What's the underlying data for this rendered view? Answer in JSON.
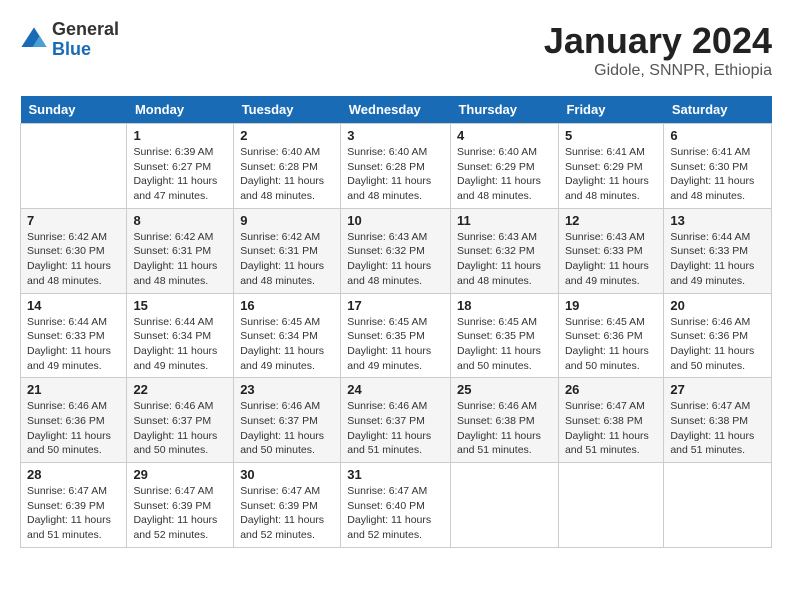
{
  "header": {
    "logo_general": "General",
    "logo_blue": "Blue",
    "month_title": "January 2024",
    "location": "Gidole, SNNPR, Ethiopia"
  },
  "weekdays": [
    "Sunday",
    "Monday",
    "Tuesday",
    "Wednesday",
    "Thursday",
    "Friday",
    "Saturday"
  ],
  "weeks": [
    [
      null,
      {
        "day": 1,
        "sunrise": "6:39 AM",
        "sunset": "6:27 PM",
        "daylight": "11 hours and 47 minutes."
      },
      {
        "day": 2,
        "sunrise": "6:40 AM",
        "sunset": "6:28 PM",
        "daylight": "11 hours and 48 minutes."
      },
      {
        "day": 3,
        "sunrise": "6:40 AM",
        "sunset": "6:28 PM",
        "daylight": "11 hours and 48 minutes."
      },
      {
        "day": 4,
        "sunrise": "6:40 AM",
        "sunset": "6:29 PM",
        "daylight": "11 hours and 48 minutes."
      },
      {
        "day": 5,
        "sunrise": "6:41 AM",
        "sunset": "6:29 PM",
        "daylight": "11 hours and 48 minutes."
      },
      {
        "day": 6,
        "sunrise": "6:41 AM",
        "sunset": "6:30 PM",
        "daylight": "11 hours and 48 minutes."
      }
    ],
    [
      {
        "day": 7,
        "sunrise": "6:42 AM",
        "sunset": "6:30 PM",
        "daylight": "11 hours and 48 minutes."
      },
      {
        "day": 8,
        "sunrise": "6:42 AM",
        "sunset": "6:31 PM",
        "daylight": "11 hours and 48 minutes."
      },
      {
        "day": 9,
        "sunrise": "6:42 AM",
        "sunset": "6:31 PM",
        "daylight": "11 hours and 48 minutes."
      },
      {
        "day": 10,
        "sunrise": "6:43 AM",
        "sunset": "6:32 PM",
        "daylight": "11 hours and 48 minutes."
      },
      {
        "day": 11,
        "sunrise": "6:43 AM",
        "sunset": "6:32 PM",
        "daylight": "11 hours and 48 minutes."
      },
      {
        "day": 12,
        "sunrise": "6:43 AM",
        "sunset": "6:33 PM",
        "daylight": "11 hours and 49 minutes."
      },
      {
        "day": 13,
        "sunrise": "6:44 AM",
        "sunset": "6:33 PM",
        "daylight": "11 hours and 49 minutes."
      }
    ],
    [
      {
        "day": 14,
        "sunrise": "6:44 AM",
        "sunset": "6:33 PM",
        "daylight": "11 hours and 49 minutes."
      },
      {
        "day": 15,
        "sunrise": "6:44 AM",
        "sunset": "6:34 PM",
        "daylight": "11 hours and 49 minutes."
      },
      {
        "day": 16,
        "sunrise": "6:45 AM",
        "sunset": "6:34 PM",
        "daylight": "11 hours and 49 minutes."
      },
      {
        "day": 17,
        "sunrise": "6:45 AM",
        "sunset": "6:35 PM",
        "daylight": "11 hours and 49 minutes."
      },
      {
        "day": 18,
        "sunrise": "6:45 AM",
        "sunset": "6:35 PM",
        "daylight": "11 hours and 50 minutes."
      },
      {
        "day": 19,
        "sunrise": "6:45 AM",
        "sunset": "6:36 PM",
        "daylight": "11 hours and 50 minutes."
      },
      {
        "day": 20,
        "sunrise": "6:46 AM",
        "sunset": "6:36 PM",
        "daylight": "11 hours and 50 minutes."
      }
    ],
    [
      {
        "day": 21,
        "sunrise": "6:46 AM",
        "sunset": "6:36 PM",
        "daylight": "11 hours and 50 minutes."
      },
      {
        "day": 22,
        "sunrise": "6:46 AM",
        "sunset": "6:37 PM",
        "daylight": "11 hours and 50 minutes."
      },
      {
        "day": 23,
        "sunrise": "6:46 AM",
        "sunset": "6:37 PM",
        "daylight": "11 hours and 50 minutes."
      },
      {
        "day": 24,
        "sunrise": "6:46 AM",
        "sunset": "6:37 PM",
        "daylight": "11 hours and 51 minutes."
      },
      {
        "day": 25,
        "sunrise": "6:46 AM",
        "sunset": "6:38 PM",
        "daylight": "11 hours and 51 minutes."
      },
      {
        "day": 26,
        "sunrise": "6:47 AM",
        "sunset": "6:38 PM",
        "daylight": "11 hours and 51 minutes."
      },
      {
        "day": 27,
        "sunrise": "6:47 AM",
        "sunset": "6:38 PM",
        "daylight": "11 hours and 51 minutes."
      }
    ],
    [
      {
        "day": 28,
        "sunrise": "6:47 AM",
        "sunset": "6:39 PM",
        "daylight": "11 hours and 51 minutes."
      },
      {
        "day": 29,
        "sunrise": "6:47 AM",
        "sunset": "6:39 PM",
        "daylight": "11 hours and 52 minutes."
      },
      {
        "day": 30,
        "sunrise": "6:47 AM",
        "sunset": "6:39 PM",
        "daylight": "11 hours and 52 minutes."
      },
      {
        "day": 31,
        "sunrise": "6:47 AM",
        "sunset": "6:40 PM",
        "daylight": "11 hours and 52 minutes."
      },
      null,
      null,
      null
    ]
  ]
}
